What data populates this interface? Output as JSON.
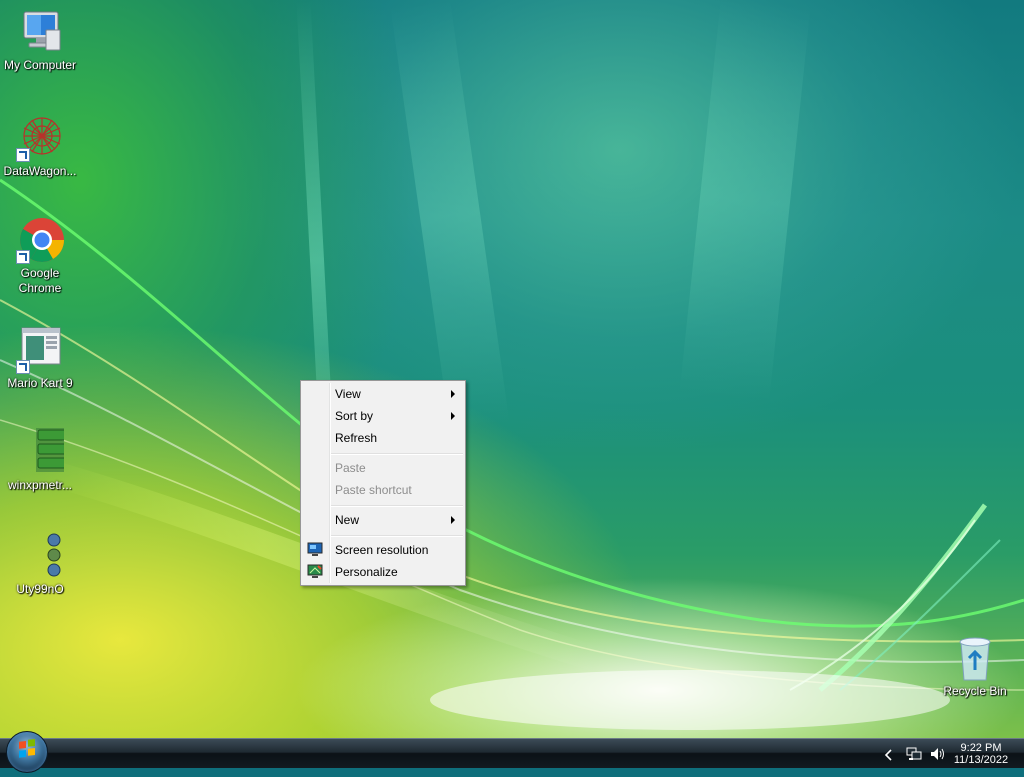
{
  "desktop": {
    "icons": [
      {
        "label": "My Computer",
        "icon": "computer-icon"
      },
      {
        "label": "DataWagon...",
        "icon": "datawagon-icon"
      },
      {
        "label": "Google Chrome",
        "icon": "chrome-icon"
      },
      {
        "label": "Mario Kart 9",
        "icon": "window-app-icon"
      },
      {
        "label": "winxpmetr...",
        "icon": "start-buttons-icon"
      },
      {
        "label": "Uty99nO",
        "icon": "orbs-icon"
      },
      {
        "label": "Recycle Bin",
        "icon": "recycle-bin-icon"
      }
    ]
  },
  "context_menu": {
    "items": [
      {
        "label": "View",
        "submenu": true,
        "enabled": true
      },
      {
        "label": "Sort by",
        "submenu": true,
        "enabled": true
      },
      {
        "label": "Refresh",
        "submenu": false,
        "enabled": true
      },
      {
        "label": "Paste",
        "submenu": false,
        "enabled": false
      },
      {
        "label": "Paste shortcut",
        "submenu": false,
        "enabled": false
      },
      {
        "label": "New",
        "submenu": true,
        "enabled": true
      },
      {
        "label": "Screen resolution",
        "submenu": false,
        "enabled": true,
        "icon": "screen-resolution-icon"
      },
      {
        "label": "Personalize",
        "submenu": false,
        "enabled": true,
        "icon": "personalize-icon"
      }
    ]
  },
  "taskbar": {
    "clock_time": "9:22 PM",
    "clock_date": "11/13/2022",
    "tray_icons": [
      "show-hidden-icons-chevron-icon",
      "network-icon",
      "volume-icon"
    ]
  },
  "colors": {
    "menu_bg": "#f1f1f1",
    "menu_disabled_text": "#8d8d8d",
    "taskbar_bg": "#121a20"
  }
}
